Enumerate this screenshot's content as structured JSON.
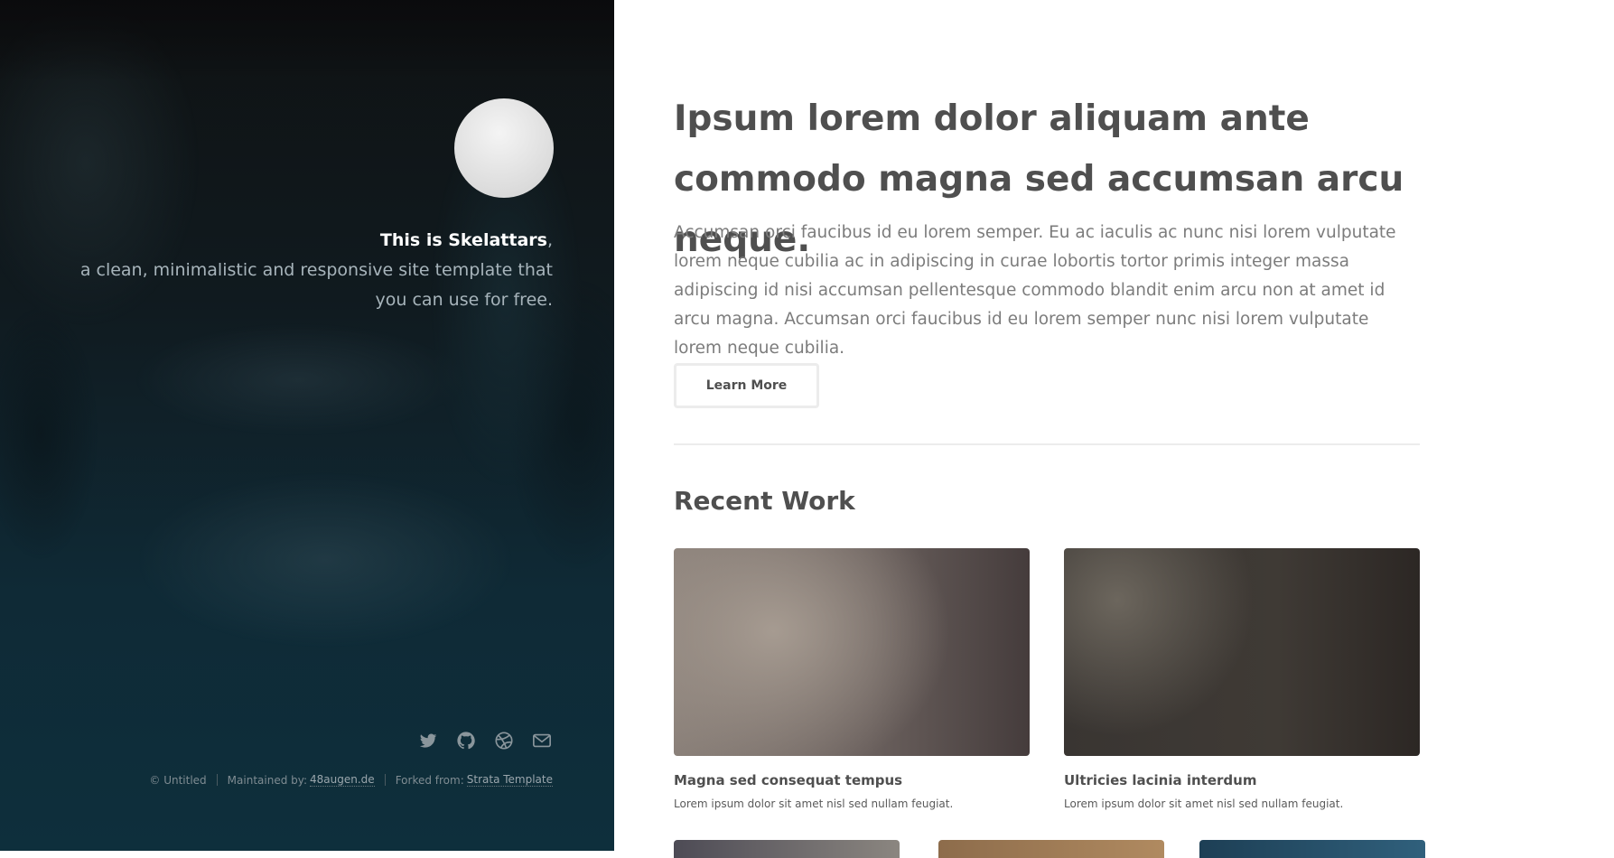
{
  "sidebar": {
    "tagline_strong": "This is Skelattars",
    "tagline_comma": ",",
    "tagline_rest": "a clean, minimalistic and responsive site template that you can use for free.",
    "social_icons": [
      "twitter-icon",
      "github-icon",
      "dribbble-icon",
      "envelope-icon"
    ],
    "footer": {
      "copyright": "© Untitled",
      "maintained_label": "Maintained by:",
      "maintained_link": "48augen.de",
      "forked_label": "Forked from:",
      "forked_link": "Strata Template"
    }
  },
  "main": {
    "headline": "Ipsum lorem dolor aliquam ante commodo magna sed accumsan arcu neque.",
    "intro": "Accumsan orci faucibus id eu lorem semper. Eu ac iaculis ac nunc nisi lorem vulputate lorem neque cubilia ac in adipiscing in curae lobortis tortor primis integer massa adipiscing id nisi accumsan pellentesque commodo blandit enim arcu non at amet id arcu magna. Accumsan orci faucibus id eu lorem semper nunc nisi lorem vulputate lorem neque cubilia.",
    "button_label": "Learn More",
    "section_title": "Recent Work",
    "works": [
      {
        "title": "Magna sed consequat tempus",
        "desc": "Lorem ipsum dolor sit amet nisl sed nullam feugiat."
      },
      {
        "title": "Ultricies lacinia interdum",
        "desc": "Lorem ipsum dolor sit amet nisl sed nullam feugiat."
      }
    ]
  },
  "colors": {
    "sidebar_top": "#0f1213",
    "sidebar_bottom": "#0e2f3c",
    "text_dark": "#4f4f4f",
    "text_muted": "#7c7c7c",
    "border": "#ececec"
  }
}
